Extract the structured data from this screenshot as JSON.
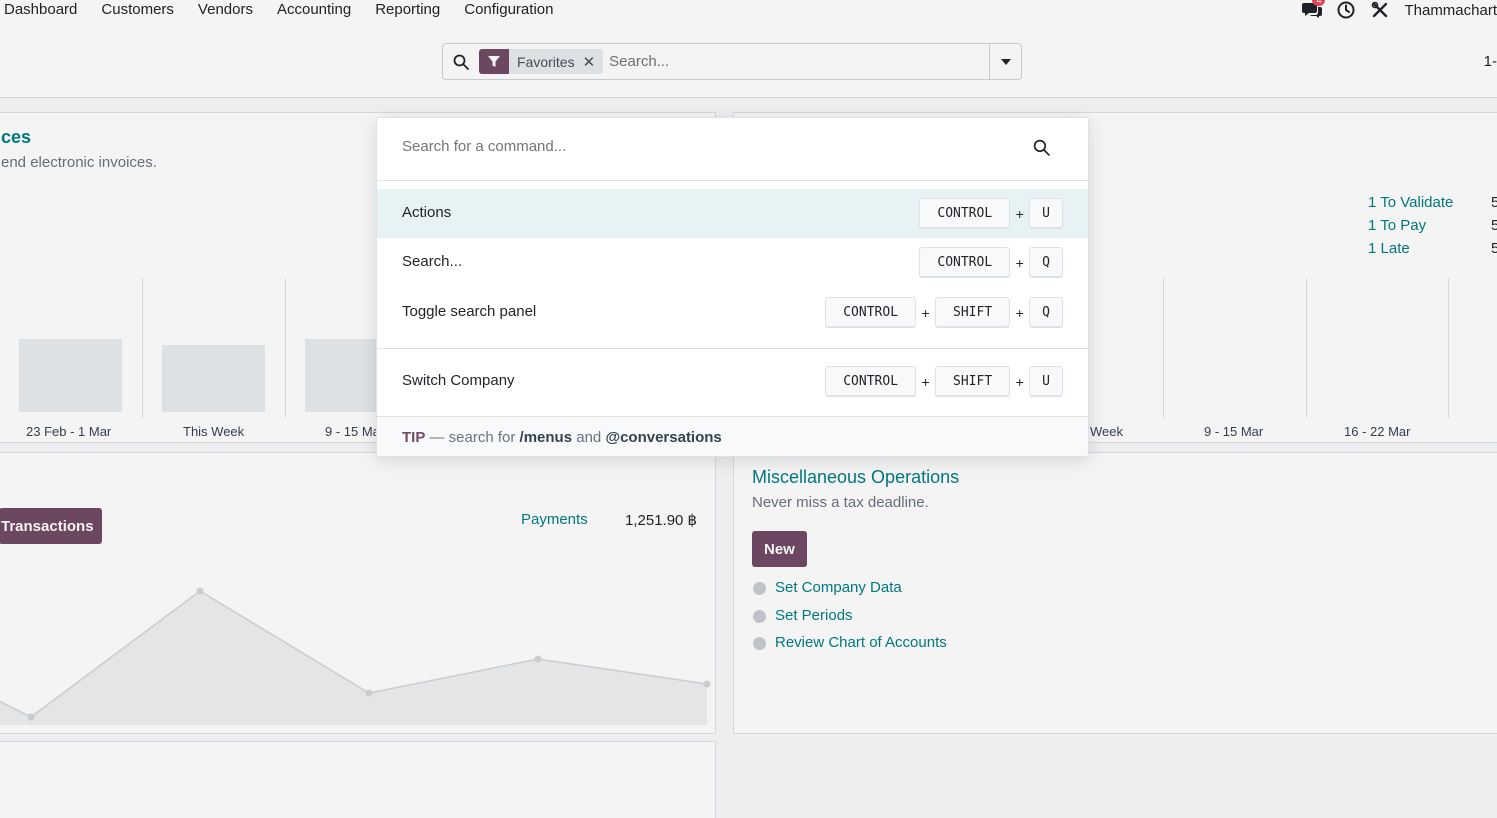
{
  "navbar": {
    "menu": [
      "Dashboard",
      "Customers",
      "Vendors",
      "Accounting",
      "Reporting",
      "Configuration"
    ],
    "message_badge": "4",
    "user_name": "Thammachart",
    "icons": [
      "chat-icon",
      "clock-icon",
      "tools-icon"
    ]
  },
  "control_panel": {
    "facet_label": "Favorites",
    "search_placeholder": "Search...",
    "pager": "1-"
  },
  "invoices_card": {
    "title": "ces",
    "subtitle": "end electronic invoices.",
    "axis_labels": [
      "23 Feb - 1 Mar",
      "This Week",
      "9 - 15 Ma"
    ]
  },
  "bills_card": {
    "stats": [
      {
        "label": "1 To Validate",
        "value": "5"
      },
      {
        "label": "1 To Pay",
        "value": "5"
      },
      {
        "label": "1 Late",
        "value": "5"
      }
    ],
    "axis_labels": [
      "Week",
      "9 - 15 Mar",
      "16 - 22 Mar"
    ]
  },
  "bank_card": {
    "button": "Transactions",
    "payments_label": "Payments",
    "payments_amount": "1,251.90 ฿"
  },
  "misc_card": {
    "title": "Miscellaneous Operations",
    "subtitle": "Never miss a tax deadline.",
    "new_button": "New",
    "steps": [
      "Set Company Data",
      "Set Periods",
      "Review Chart of Accounts"
    ]
  },
  "command_palette": {
    "placeholder": "Search for a command...",
    "commands": [
      {
        "label": "Actions",
        "keys": [
          "CONTROL",
          "U"
        ],
        "active": true
      },
      {
        "label": "Search...",
        "keys": [
          "CONTROL",
          "Q"
        ],
        "active": false
      },
      {
        "label": "Toggle search panel",
        "keys": [
          "CONTROL",
          "SHIFT",
          "Q"
        ],
        "active": false
      },
      {
        "label": "Switch Company",
        "keys": [
          "CONTROL",
          "SHIFT",
          "U"
        ],
        "active": false
      }
    ],
    "footer": {
      "tip": "TIP",
      "dash_text": " — search for ",
      "menus": "/menus",
      "and_text": " and ",
      "conversations": "@conversations"
    }
  },
  "colors": {
    "brand": "#714b67",
    "accent": "#017e84",
    "active_row": "#e6f2f3",
    "badge": "#e4495b"
  }
}
